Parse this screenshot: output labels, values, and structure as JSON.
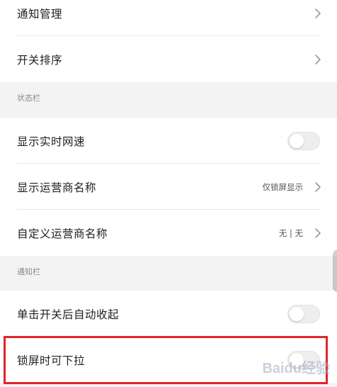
{
  "colors": {
    "background": "#f3f3f3",
    "card": "#ffffff",
    "text_primary": "#1f1f1f",
    "text_secondary": "#8a8a8a",
    "highlight_border": "#e0242c"
  },
  "group1": {
    "items": [
      {
        "label": "通知管理",
        "control": "chevron-right-icon"
      },
      {
        "label": "开关排序",
        "control": "chevron-right-icon"
      }
    ]
  },
  "status_bar": {
    "header": "状态栏",
    "items": [
      {
        "label": "显示实时网速",
        "control": "toggle",
        "on": false
      },
      {
        "label": "显示运营商名称",
        "value": "仅锁屏显示",
        "control": "chevron-right-icon"
      },
      {
        "label": "自定义运营商名称",
        "value": "无 | 无",
        "control": "chevron-right-icon"
      }
    ]
  },
  "notification_bar": {
    "header": "通知栏",
    "items": [
      {
        "label": "单击开关后自动收起",
        "control": "toggle",
        "on": false
      },
      {
        "label": "锁屏时可下拉",
        "control": "toggle",
        "on": false
      }
    ]
  },
  "watermark": {
    "text": "Baidu经验"
  }
}
